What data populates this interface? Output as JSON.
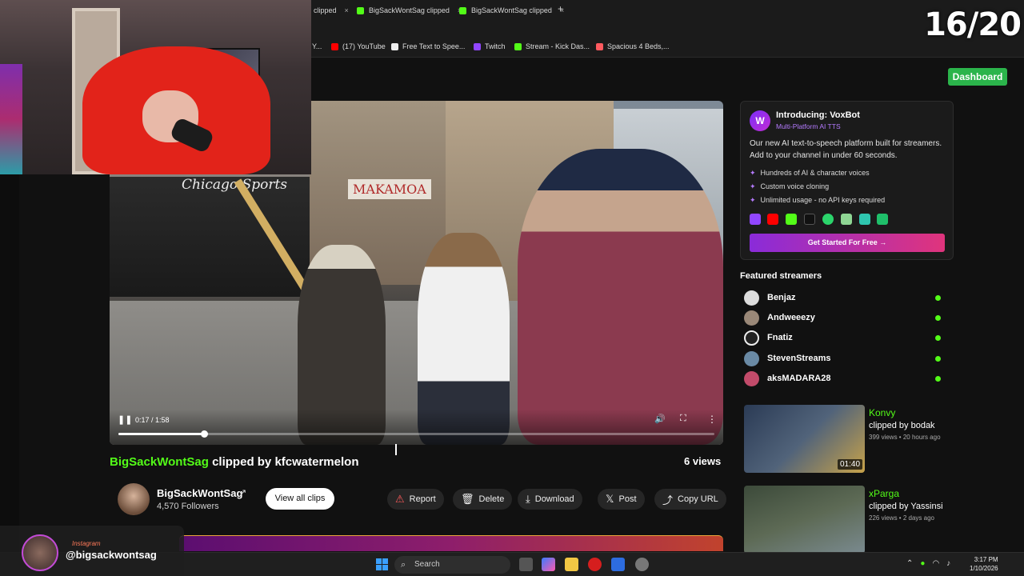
{
  "browser": {
    "tabs": [
      {
        "label": "clipped"
      },
      {
        "label": "BigSackWontSag clipped"
      },
      {
        "label": "BigSackWontSag clipped"
      }
    ],
    "new_tab": "+",
    "bookmarks": [
      {
        "label": "Y..."
      },
      {
        "label": "(17) YouTube"
      },
      {
        "label": "Free Text to Spee..."
      },
      {
        "label": "Twitch"
      },
      {
        "label": "Stream - Kick Das..."
      },
      {
        "label": "Spacious 4 Beds,..."
      }
    ]
  },
  "overlay": {
    "counter": "16/20",
    "social_label": "Instagram",
    "social_handle": "@bigsackwontsag"
  },
  "header": {
    "dashboard_label": "Dashboard"
  },
  "video": {
    "time": "0:17 / 1:58",
    "progress": 0.144,
    "sign_chicago": "Chicago Sports",
    "sign_store": "MAKAMOA",
    "pause_icon": "pause-icon",
    "controls": [
      "volume-icon",
      "fullscreen-icon",
      "more-icon"
    ]
  },
  "clip": {
    "channel": "BigSackWontSag",
    "clipped_by_text": "clipped by kfcwatermelon",
    "views": "6 views",
    "channel_name": "BigSackWontSag",
    "followers": "4,570 Followers",
    "view_all": "View all clips",
    "actions": {
      "report": "Report",
      "delete": "Delete",
      "download": "Download",
      "post": "Post",
      "copy_url": "Copy URL"
    }
  },
  "voxbot": {
    "title": "Introducing: VoxBot",
    "subtitle": "Multi-Platform AI TTS",
    "description": "Our new AI text-to-speech platform built for streamers. Add to your channel in under 60 seconds.",
    "features": [
      "Hundreds of AI & character voices",
      "Custom voice cloning",
      "Unlimited usage - no API keys required"
    ],
    "cta": "Get Started For Free →",
    "accent": "#b57bff"
  },
  "featured": {
    "heading": "Featured streamers",
    "streamers": [
      {
        "name": "Benjaz"
      },
      {
        "name": "Andweeezy"
      },
      {
        "name": "Fnatiz"
      },
      {
        "name": "StevenStreams"
      },
      {
        "name": "aksMADARA28"
      }
    ],
    "live_color": "#53fc18"
  },
  "related": [
    {
      "title": "Konvy",
      "by": "clipped by bodak",
      "meta": "399 views • 20 hours ago",
      "duration": "01:40"
    },
    {
      "title": "xParga",
      "by": "clipped by Yassinsi",
      "meta": "226 views • 2 days ago",
      "duration": ""
    }
  ],
  "taskbar": {
    "search": "Search",
    "time": "3:17 PM",
    "date": "1/10/2026"
  },
  "colors": {
    "brand": "#53fc18",
    "dashboard": "#2bb44b"
  }
}
